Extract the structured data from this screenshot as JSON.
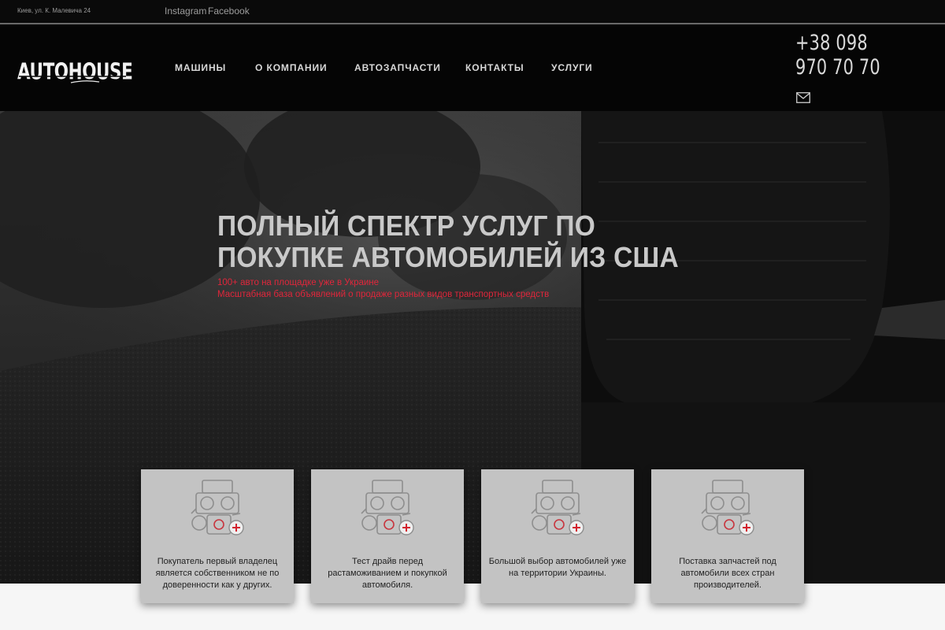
{
  "topbar": {
    "address": "Киев, ул. К. Малевича 24",
    "social": [
      "Instagram",
      "Facebook"
    ]
  },
  "header": {
    "logo_text": "AUTOHOUSE",
    "nav": [
      "МАШИНЫ",
      "О КОМПАНИИ",
      "АВТОЗАПЧАСТИ",
      "КОНТАКТЫ",
      "УСЛУГИ"
    ],
    "phone": "+38 098 970 70 70",
    "mail_icon": "envelope-icon"
  },
  "hero": {
    "title": "ПОЛНЫЙ СПЕКТР УСЛУГ ПО ПОКУПКЕ АВТОМОБИЛЕЙ ИЗ США",
    "sub_line1": "100+ авто на площадке уже в Украине",
    "sub_line2": "Масштабная база объявлений о продаже разных видов транспортных средств"
  },
  "features": [
    {
      "icon": "engine-icon",
      "text": "Покупатель первый владелец является собственником не по доверенности как у других."
    },
    {
      "icon": "engine-icon",
      "text": "Тест драйв перед растаможиванием и покупкой автомобиля."
    },
    {
      "icon": "engine-icon",
      "text": "Большой выбор автомобилей уже на территории Украины."
    },
    {
      "icon": "engine-icon",
      "text": "Поставка запчастей под автомобили всех стран производителей."
    }
  ],
  "colors": {
    "accent_red": "#e0263b",
    "background": "#050505",
    "card": "#c3c3c3"
  }
}
